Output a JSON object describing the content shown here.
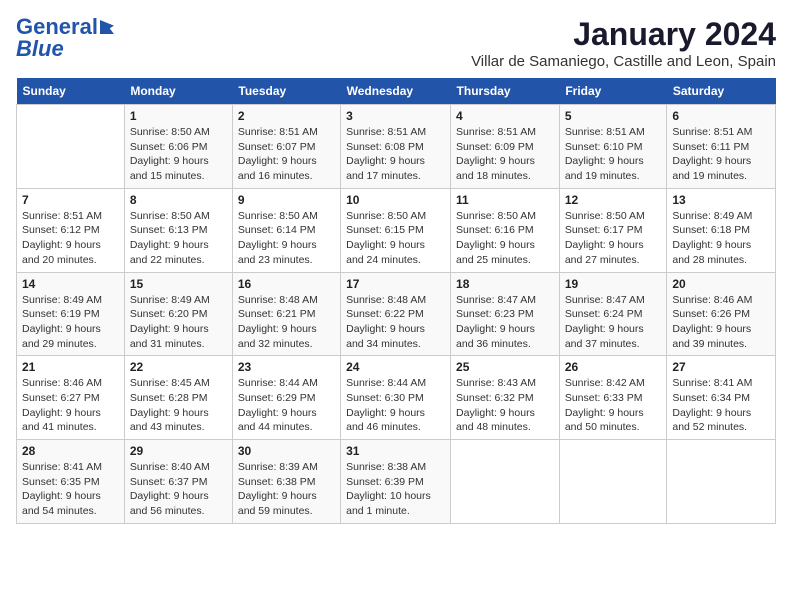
{
  "header": {
    "logo_line1": "General",
    "logo_line2": "Blue",
    "title": "January 2024",
    "subtitle": "Villar de Samaniego, Castille and Leon, Spain"
  },
  "days_of_week": [
    "Sunday",
    "Monday",
    "Tuesday",
    "Wednesday",
    "Thursday",
    "Friday",
    "Saturday"
  ],
  "weeks": [
    [
      {
        "day": "",
        "sunrise": "",
        "sunset": "",
        "daylight": ""
      },
      {
        "day": "1",
        "sunrise": "Sunrise: 8:50 AM",
        "sunset": "Sunset: 6:06 PM",
        "daylight": "Daylight: 9 hours and 15 minutes."
      },
      {
        "day": "2",
        "sunrise": "Sunrise: 8:51 AM",
        "sunset": "Sunset: 6:07 PM",
        "daylight": "Daylight: 9 hours and 16 minutes."
      },
      {
        "day": "3",
        "sunrise": "Sunrise: 8:51 AM",
        "sunset": "Sunset: 6:08 PM",
        "daylight": "Daylight: 9 hours and 17 minutes."
      },
      {
        "day": "4",
        "sunrise": "Sunrise: 8:51 AM",
        "sunset": "Sunset: 6:09 PM",
        "daylight": "Daylight: 9 hours and 18 minutes."
      },
      {
        "day": "5",
        "sunrise": "Sunrise: 8:51 AM",
        "sunset": "Sunset: 6:10 PM",
        "daylight": "Daylight: 9 hours and 19 minutes."
      },
      {
        "day": "6",
        "sunrise": "Sunrise: 8:51 AM",
        "sunset": "Sunset: 6:11 PM",
        "daylight": "Daylight: 9 hours and 19 minutes."
      }
    ],
    [
      {
        "day": "7",
        "sunrise": "Sunrise: 8:51 AM",
        "sunset": "Sunset: 6:12 PM",
        "daylight": "Daylight: 9 hours and 20 minutes."
      },
      {
        "day": "8",
        "sunrise": "Sunrise: 8:50 AM",
        "sunset": "Sunset: 6:13 PM",
        "daylight": "Daylight: 9 hours and 22 minutes."
      },
      {
        "day": "9",
        "sunrise": "Sunrise: 8:50 AM",
        "sunset": "Sunset: 6:14 PM",
        "daylight": "Daylight: 9 hours and 23 minutes."
      },
      {
        "day": "10",
        "sunrise": "Sunrise: 8:50 AM",
        "sunset": "Sunset: 6:15 PM",
        "daylight": "Daylight: 9 hours and 24 minutes."
      },
      {
        "day": "11",
        "sunrise": "Sunrise: 8:50 AM",
        "sunset": "Sunset: 6:16 PM",
        "daylight": "Daylight: 9 hours and 25 minutes."
      },
      {
        "day": "12",
        "sunrise": "Sunrise: 8:50 AM",
        "sunset": "Sunset: 6:17 PM",
        "daylight": "Daylight: 9 hours and 27 minutes."
      },
      {
        "day": "13",
        "sunrise": "Sunrise: 8:49 AM",
        "sunset": "Sunset: 6:18 PM",
        "daylight": "Daylight: 9 hours and 28 minutes."
      }
    ],
    [
      {
        "day": "14",
        "sunrise": "Sunrise: 8:49 AM",
        "sunset": "Sunset: 6:19 PM",
        "daylight": "Daylight: 9 hours and 29 minutes."
      },
      {
        "day": "15",
        "sunrise": "Sunrise: 8:49 AM",
        "sunset": "Sunset: 6:20 PM",
        "daylight": "Daylight: 9 hours and 31 minutes."
      },
      {
        "day": "16",
        "sunrise": "Sunrise: 8:48 AM",
        "sunset": "Sunset: 6:21 PM",
        "daylight": "Daylight: 9 hours and 32 minutes."
      },
      {
        "day": "17",
        "sunrise": "Sunrise: 8:48 AM",
        "sunset": "Sunset: 6:22 PM",
        "daylight": "Daylight: 9 hours and 34 minutes."
      },
      {
        "day": "18",
        "sunrise": "Sunrise: 8:47 AM",
        "sunset": "Sunset: 6:23 PM",
        "daylight": "Daylight: 9 hours and 36 minutes."
      },
      {
        "day": "19",
        "sunrise": "Sunrise: 8:47 AM",
        "sunset": "Sunset: 6:24 PM",
        "daylight": "Daylight: 9 hours and 37 minutes."
      },
      {
        "day": "20",
        "sunrise": "Sunrise: 8:46 AM",
        "sunset": "Sunset: 6:26 PM",
        "daylight": "Daylight: 9 hours and 39 minutes."
      }
    ],
    [
      {
        "day": "21",
        "sunrise": "Sunrise: 8:46 AM",
        "sunset": "Sunset: 6:27 PM",
        "daylight": "Daylight: 9 hours and 41 minutes."
      },
      {
        "day": "22",
        "sunrise": "Sunrise: 8:45 AM",
        "sunset": "Sunset: 6:28 PM",
        "daylight": "Daylight: 9 hours and 43 minutes."
      },
      {
        "day": "23",
        "sunrise": "Sunrise: 8:44 AM",
        "sunset": "Sunset: 6:29 PM",
        "daylight": "Daylight: 9 hours and 44 minutes."
      },
      {
        "day": "24",
        "sunrise": "Sunrise: 8:44 AM",
        "sunset": "Sunset: 6:30 PM",
        "daylight": "Daylight: 9 hours and 46 minutes."
      },
      {
        "day": "25",
        "sunrise": "Sunrise: 8:43 AM",
        "sunset": "Sunset: 6:32 PM",
        "daylight": "Daylight: 9 hours and 48 minutes."
      },
      {
        "day": "26",
        "sunrise": "Sunrise: 8:42 AM",
        "sunset": "Sunset: 6:33 PM",
        "daylight": "Daylight: 9 hours and 50 minutes."
      },
      {
        "day": "27",
        "sunrise": "Sunrise: 8:41 AM",
        "sunset": "Sunset: 6:34 PM",
        "daylight": "Daylight: 9 hours and 52 minutes."
      }
    ],
    [
      {
        "day": "28",
        "sunrise": "Sunrise: 8:41 AM",
        "sunset": "Sunset: 6:35 PM",
        "daylight": "Daylight: 9 hours and 54 minutes."
      },
      {
        "day": "29",
        "sunrise": "Sunrise: 8:40 AM",
        "sunset": "Sunset: 6:37 PM",
        "daylight": "Daylight: 9 hours and 56 minutes."
      },
      {
        "day": "30",
        "sunrise": "Sunrise: 8:39 AM",
        "sunset": "Sunset: 6:38 PM",
        "daylight": "Daylight: 9 hours and 59 minutes."
      },
      {
        "day": "31",
        "sunrise": "Sunrise: 8:38 AM",
        "sunset": "Sunset: 6:39 PM",
        "daylight": "Daylight: 10 hours and 1 minute."
      },
      {
        "day": "",
        "sunrise": "",
        "sunset": "",
        "daylight": ""
      },
      {
        "day": "",
        "sunrise": "",
        "sunset": "",
        "daylight": ""
      },
      {
        "day": "",
        "sunrise": "",
        "sunset": "",
        "daylight": ""
      }
    ]
  ]
}
